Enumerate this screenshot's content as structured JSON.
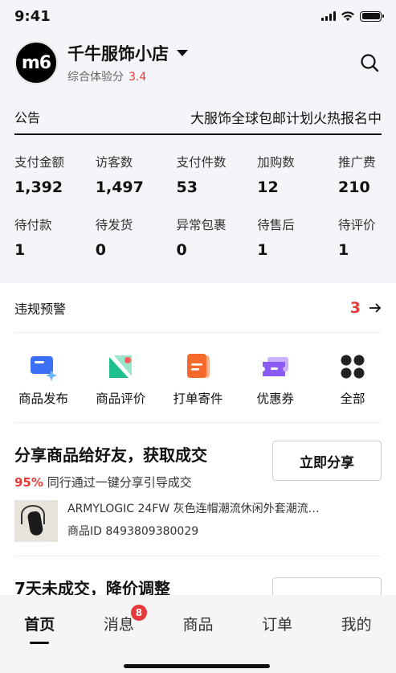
{
  "status_bar": {
    "time": "9:41"
  },
  "shop": {
    "logo_text": "m6",
    "name": "千牛服饰小店",
    "score_label": "综合体验分",
    "score_value": "3.4"
  },
  "notice": {
    "label": "公告",
    "text": "大服饰全球包邮计划火热报名中"
  },
  "stats_row1": [
    {
      "label": "支付金额",
      "value": "1,392"
    },
    {
      "label": "访客数",
      "value": "1,497"
    },
    {
      "label": "支付件数",
      "value": "53"
    },
    {
      "label": "加购数",
      "value": "12"
    },
    {
      "label": "推广费",
      "value": "210"
    }
  ],
  "stats_row2": [
    {
      "label": "待付款",
      "value": "1"
    },
    {
      "label": "待发货",
      "value": "0"
    },
    {
      "label": "异常包裹",
      "value": "0"
    },
    {
      "label": "待售后",
      "value": "1"
    },
    {
      "label": "待评价",
      "value": "1"
    }
  ],
  "violation": {
    "label": "违规预警",
    "count": "3"
  },
  "tools": [
    {
      "label": "商品发布",
      "icon": "product-publish-icon",
      "color": "#3b6ff5"
    },
    {
      "label": "商品评价",
      "icon": "product-review-icon",
      "color": "#1fbf8f"
    },
    {
      "label": "打单寄件",
      "icon": "print-ship-icon",
      "color": "#f56a2a"
    },
    {
      "label": "优惠券",
      "icon": "coupon-icon",
      "color": "#8a5cf5"
    },
    {
      "label": "全部",
      "icon": "grid-all-icon",
      "color": "#222222"
    }
  ],
  "share": {
    "title": "分享商品给好友，获取成交",
    "pct": "95%",
    "subtitle": "同行通过一键分享引导成交",
    "button": "立即分享",
    "product_title": "ARMYLOGIC 24FW 灰色连帽潮流休闲外套潮流…",
    "product_id": "商品ID 8493809380029"
  },
  "next_card": {
    "title": "7天未成交，降价调整"
  },
  "tabbar": {
    "tabs": [
      "首页",
      "消息",
      "商品",
      "订单",
      "我的"
    ],
    "message_badge": "8"
  },
  "colors": {
    "accent_red": "#e63a3a",
    "header_bg": "#f5f4f8"
  }
}
